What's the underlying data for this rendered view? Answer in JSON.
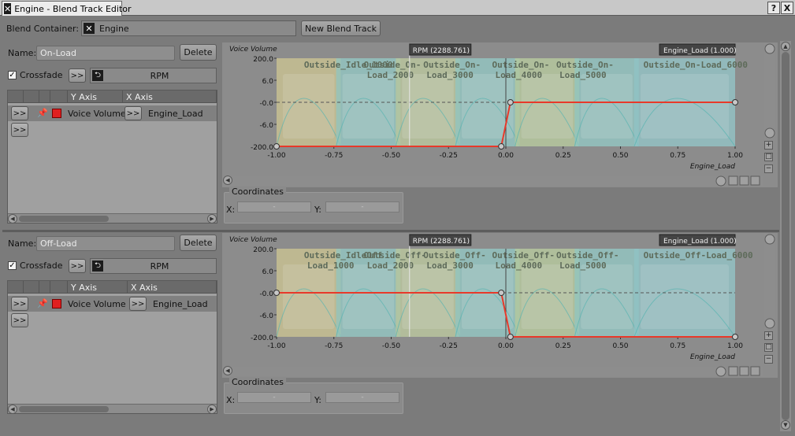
{
  "window": {
    "title": "Engine - Blend Track Editor",
    "help_label": "?",
    "close_label": "X"
  },
  "header": {
    "blend_container_label": "Blend Container:",
    "blend_container_value": "Engine",
    "new_blend_track_label": "New Blend Track"
  },
  "tracks": [
    {
      "name_label": "Name:",
      "name_value": "On-Load",
      "delete_label": "Delete",
      "crossfade_label": "Crossfade",
      "crossfade_checked": true,
      "rpm_label": "RPM",
      "arrow_label": ">>",
      "table": {
        "col_y": "Y Axis",
        "col_x": "X Axis",
        "row_y": "Voice Volume",
        "row_x": "Engine_Load"
      },
      "graph": {
        "y_title": "Voice Volume",
        "x_title": "Engine_Load",
        "rpm_marker": "RPM (2288.761)",
        "engine_load_marker": "Engine_Load (1.000)",
        "y_ticks": [
          "200.0",
          "6.0",
          "-0.0",
          "-6.0",
          "-200.0"
        ],
        "x_ticks": [
          "-1.00",
          "-0.75",
          "-0.50",
          "-0.25",
          "0.00",
          "0.25",
          "0.50",
          "0.75",
          "1.00"
        ],
        "sounds": [
          {
            "l1": "Outside_Idle_1000",
            "l2": ""
          },
          {
            "l1": "Outside_On-",
            "l2": "Load_2000"
          },
          {
            "l1": "Outside_On-",
            "l2": "Load_3000"
          },
          {
            "l1": "Outside_On-",
            "l2": "Load_4000"
          },
          {
            "l1": "Outside_On-",
            "l2": "Load_5000"
          },
          {
            "l1": "Outside_On-Load_6000",
            "l2": ""
          }
        ],
        "curve": {
          "x": [
            -1.0,
            -0.02,
            0.02,
            1.0
          ],
          "y": [
            -200.0,
            -200.0,
            -0.0,
            -0.0
          ]
        }
      },
      "coordinates": {
        "title": "Coordinates",
        "x_label": "X:",
        "y_label": "Y:",
        "x_value": "-",
        "y_value": "-"
      }
    },
    {
      "name_label": "Name:",
      "name_value": "Off-Load",
      "delete_label": "Delete",
      "crossfade_label": "Crossfade",
      "crossfade_checked": true,
      "rpm_label": "RPM",
      "arrow_label": ">>",
      "table": {
        "col_y": "Y Axis",
        "col_x": "X Axis",
        "row_y": "Voice Volume",
        "row_x": "Engine_Load"
      },
      "graph": {
        "y_title": "Voice Volume",
        "x_title": "Engine_Load",
        "rpm_marker": "RPM (2288.761)",
        "engine_load_marker": "Engine_Load (1.000)",
        "y_ticks": [
          "200.0",
          "6.0",
          "-0.0",
          "-6.0",
          "-200.0"
        ],
        "x_ticks": [
          "-1.00",
          "-0.75",
          "-0.50",
          "-0.25",
          "0.00",
          "0.25",
          "0.50",
          "0.75",
          "1.00"
        ],
        "sounds": [
          {
            "l1": "Outside_IdleOff",
            "l2": "Load_1000"
          },
          {
            "l1": "Outside_Off-",
            "l2": "Load_2000"
          },
          {
            "l1": "Outside_Off-",
            "l2": "Load_3000"
          },
          {
            "l1": "Outside_Off-",
            "l2": "Load_4000"
          },
          {
            "l1": "Outside_Off-",
            "l2": "Load_5000"
          },
          {
            "l1": "Outside_Off-Load_6000",
            "l2": ""
          }
        ],
        "curve": {
          "x": [
            -1.0,
            -0.02,
            0.02,
            1.0
          ],
          "y": [
            -0.0,
            -0.0,
            -200.0,
            -200.0
          ]
        }
      },
      "coordinates": {
        "title": "Coordinates",
        "x_label": "X:",
        "y_label": "Y:",
        "x_value": "-",
        "y_value": "-"
      }
    }
  ],
  "colors": {
    "curve": "#e8392a",
    "region_yellow": "#c8c290",
    "region_cyan": "#8fc3c0",
    "background": "#7b7b7b"
  }
}
